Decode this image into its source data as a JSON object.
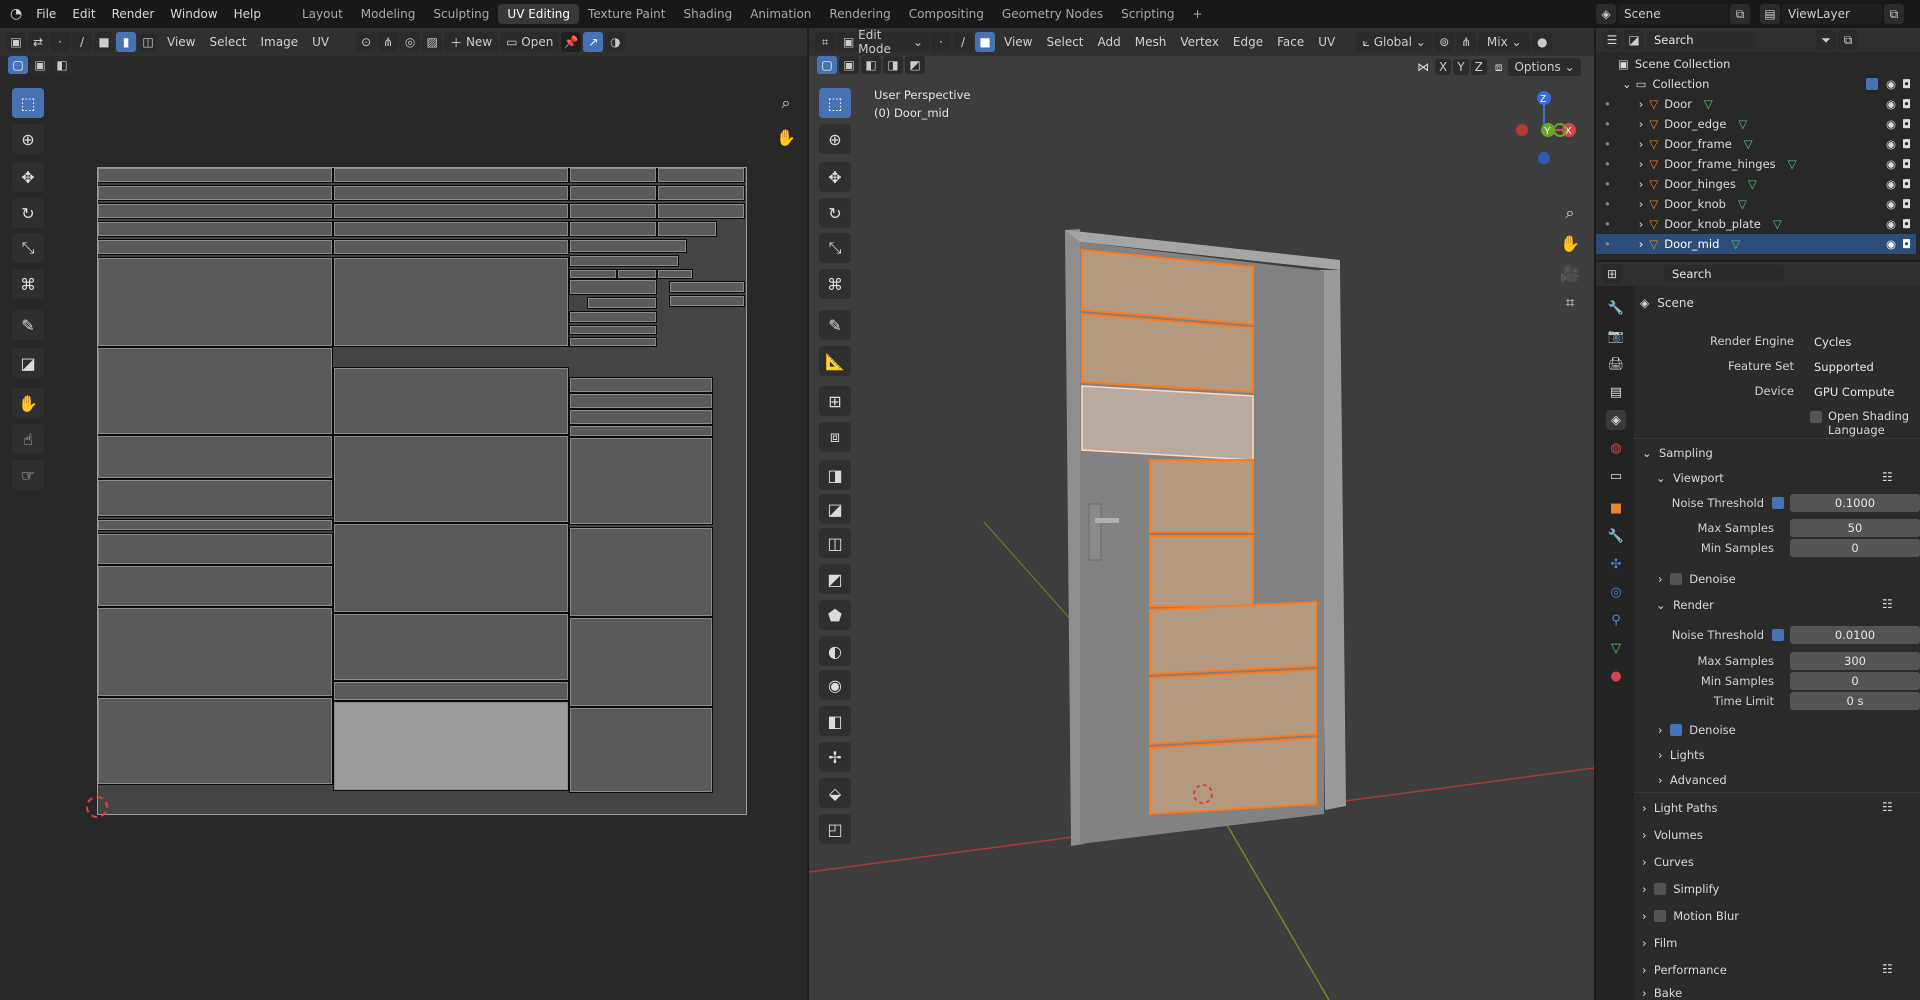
{
  "topbar": {
    "menus": [
      "File",
      "Edit",
      "Render",
      "Window",
      "Help"
    ],
    "workspaces": [
      "Layout",
      "Modeling",
      "Sculpting",
      "UV Editing",
      "Texture Paint",
      "Shading",
      "Animation",
      "Rendering",
      "Compositing",
      "Geometry Nodes",
      "Scripting"
    ],
    "active_workspace": "UV Editing",
    "scene": "Scene",
    "view_layer": "ViewLayer"
  },
  "uv_editor": {
    "menus": [
      "View",
      "Select",
      "Image",
      "UV"
    ],
    "new_label": "New",
    "open_label": "Open"
  },
  "viewport": {
    "mode": "Edit Mode",
    "menus": [
      "View",
      "Select",
      "Add",
      "Mesh",
      "Vertex",
      "Edge",
      "Face",
      "UV"
    ],
    "orientation": "Global",
    "shading_mix": "Mix",
    "axes": [
      "X",
      "Y",
      "Z"
    ],
    "options_label": "Options",
    "perspective_label": "User Perspective",
    "object_label": "(0) Door_mid"
  },
  "outliner": {
    "search_placeholder": "Search",
    "scene_collection": "Scene Collection",
    "collection": "Collection",
    "objects": [
      "Door",
      "Door_edge",
      "Door_frame",
      "Door_frame_hinges",
      "Door_hinges",
      "Door_knob",
      "Door_knob_plate",
      "Door_mid"
    ],
    "selected_object": "Door_mid"
  },
  "properties": {
    "search_placeholder": "Search",
    "context": "Scene",
    "render_engine_label": "Render Engine",
    "render_engine": "Cycles",
    "feature_set_label": "Feature Set",
    "feature_set": "Supported",
    "device_label": "Device",
    "device": "GPU Compute",
    "osl_label": "Open Shading Language",
    "sampling": "Sampling",
    "viewport": "Viewport",
    "noise_threshold_label": "Noise Threshold",
    "viewport_noise_threshold": "0.1000",
    "max_samples_label": "Max Samples",
    "viewport_max_samples": "50",
    "min_samples_label": "Min Samples",
    "viewport_min_samples": "0",
    "denoise_label": "Denoise",
    "render": "Render",
    "render_noise_threshold": "0.0100",
    "render_max_samples": "300",
    "render_min_samples": "0",
    "time_limit_label": "Time Limit",
    "time_limit": "0 s",
    "lights": "Lights",
    "advanced": "Advanced",
    "sections": [
      "Light Paths",
      "Volumes",
      "Curves",
      "Simplify",
      "Motion Blur",
      "Film",
      "Performance",
      "Bake"
    ]
  },
  "colors": {
    "accent": "#4772b3",
    "selection_orange": "#ff7a1a",
    "grid_red": "#a83a3a",
    "grid_green": "#6a8a2a"
  }
}
